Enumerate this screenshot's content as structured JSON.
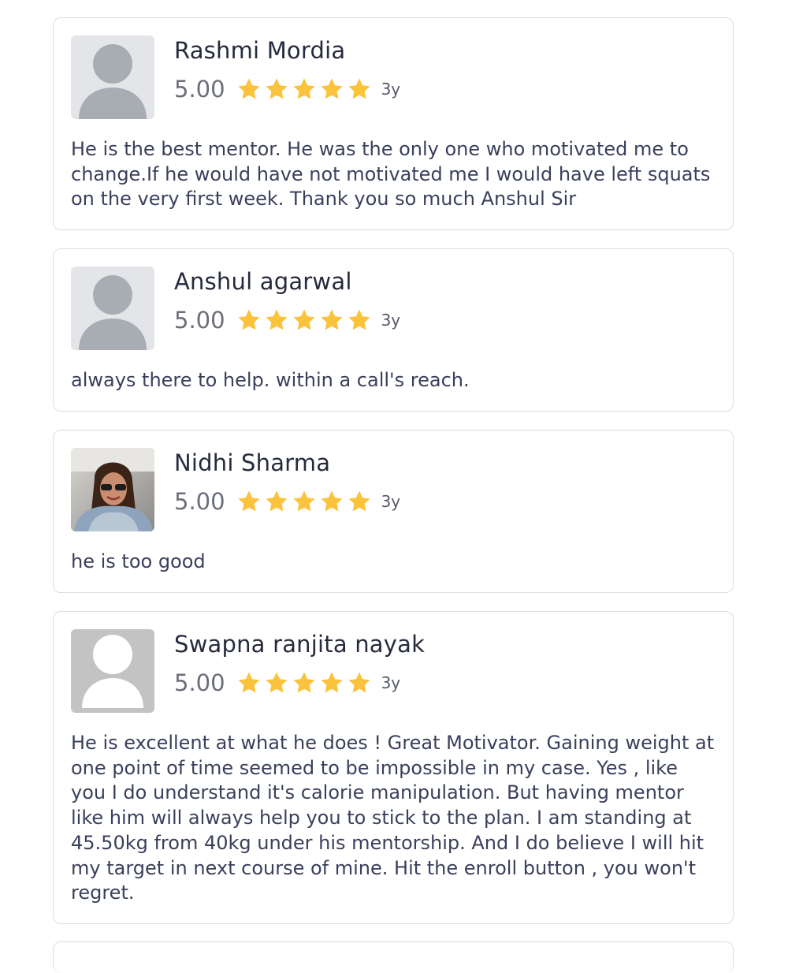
{
  "colors": {
    "star": "#fbc33c",
    "card_border": "#dcdde3",
    "name_text": "#262a3d",
    "review_text": "#3a3f5c"
  },
  "reviews": [
    {
      "name": "Rashmi Mordia",
      "rating": "5.00",
      "stars": 5,
      "age": "3y",
      "avatar": "placeholder-person-icon",
      "text": "He is the best mentor. He was the only one who motivated me to change.If he would have not motivated me I would have left squats on the very first week. Thank you so much Anshul Sir"
    },
    {
      "name": "Anshul agarwal",
      "rating": "5.00",
      "stars": 5,
      "age": "3y",
      "avatar": "placeholder-person-icon",
      "text": "always there to help. within a call's reach."
    },
    {
      "name": "Nidhi Sharma",
      "rating": "5.00",
      "stars": 5,
      "age": "3y",
      "avatar": "profile-photo",
      "text": "he is too good"
    },
    {
      "name": "Swapna ranjita nayak",
      "rating": "5.00",
      "stars": 5,
      "age": "3y",
      "avatar": "placeholder-person-icon",
      "text": "He is excellent at what he does ! Great Motivator. Gaining weight at one point of time seemed to be impossible in my case. Yes , like you I do understand it's calorie manipulation. But having mentor like him will always help you to stick to the plan. I am standing at 45.50kg from 40kg under his mentorship. And I do believe I will hit my target in next course of mine.  Hit the enroll button , you won't regret."
    }
  ]
}
